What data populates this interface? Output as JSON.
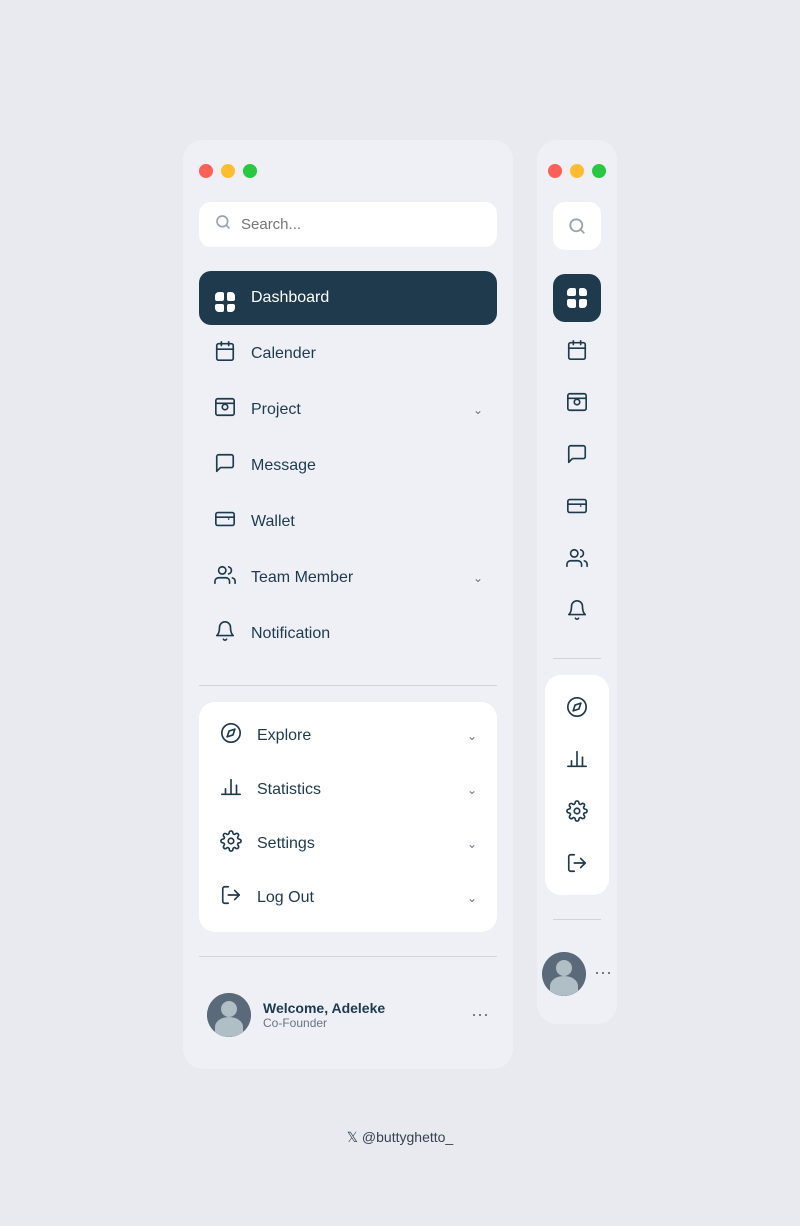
{
  "wide_sidebar": {
    "traffic_lights": [
      "red",
      "yellow",
      "green"
    ],
    "search": {
      "placeholder": "Search..."
    },
    "nav_items": [
      {
        "id": "dashboard",
        "label": "Dashboard",
        "icon": "grid",
        "active": true,
        "chevron": false
      },
      {
        "id": "calendar",
        "label": "Calender",
        "icon": "calendar",
        "active": false,
        "chevron": false
      },
      {
        "id": "project",
        "label": "Project",
        "icon": "folder",
        "active": false,
        "chevron": true
      },
      {
        "id": "message",
        "label": "Message",
        "icon": "message",
        "active": false,
        "chevron": false
      },
      {
        "id": "wallet",
        "label": "Wallet",
        "icon": "wallet",
        "active": false,
        "chevron": false
      },
      {
        "id": "team-member",
        "label": "Team Member",
        "icon": "team",
        "active": false,
        "chevron": true
      },
      {
        "id": "notification",
        "label": "Notification",
        "icon": "bell",
        "active": false,
        "chevron": false
      }
    ],
    "secondary_items": [
      {
        "id": "explore",
        "label": "Explore",
        "icon": "compass",
        "chevron": true
      },
      {
        "id": "statistics",
        "label": "Statistics",
        "icon": "chart",
        "chevron": true
      },
      {
        "id": "settings",
        "label": "Settings",
        "icon": "gear",
        "chevron": true
      },
      {
        "id": "logout",
        "label": "Log Out",
        "icon": "logout",
        "chevron": true
      }
    ],
    "user": {
      "name": "Welcome, Adeleke",
      "role": "Co-Founder"
    }
  },
  "narrow_sidebar": {
    "traffic_lights": [
      "red",
      "yellow",
      "green"
    ]
  },
  "footer": {
    "credit": "𝕏  @buttyghetto_"
  }
}
